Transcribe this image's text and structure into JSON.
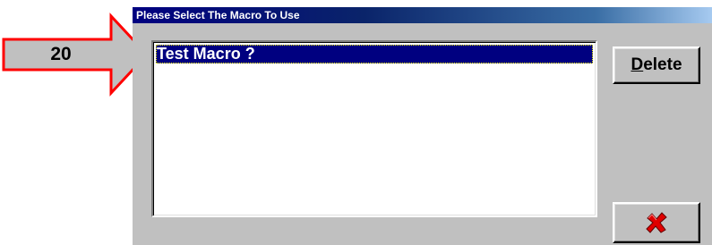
{
  "callout": {
    "label": "20",
    "arrow_fill": "#c0c0c0",
    "arrow_stroke": "#ff0000"
  },
  "dialog": {
    "title": "Please Select The Macro To Use",
    "macros": [
      {
        "label": "Test Macro ?",
        "selected": true
      }
    ],
    "delete_button": {
      "mnemonic": "D",
      "rest": "elete"
    },
    "cancel_button": {
      "icon": "red-x-icon"
    }
  },
  "colors": {
    "titlebar": "#000080",
    "selection": "#000080",
    "face": "#c0c0c0",
    "cancel_icon": "#e00000"
  }
}
